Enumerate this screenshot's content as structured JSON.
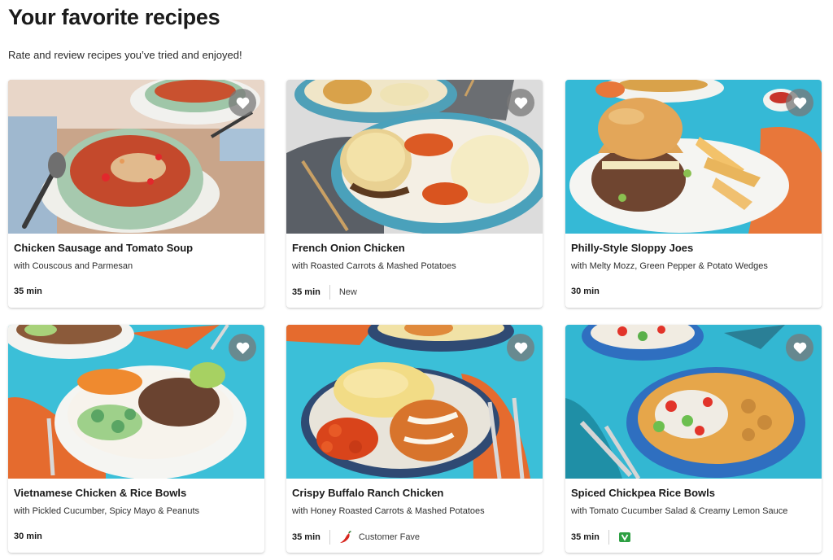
{
  "page": {
    "title": "Your favorite recipes",
    "subtitle": "Rate and review recipes you’ve tried and enjoyed!"
  },
  "colors": {
    "heart_bg": "#7a7a7a",
    "chili": "#d7261e",
    "veggie": "#2ea043",
    "separator": "#d0d0d0"
  },
  "recipes": [
    {
      "title": "Chicken Sausage and Tomato Soup",
      "subtitle": "with Couscous and Parmesan",
      "time": "35 min",
      "tag": "",
      "tag_icon": ""
    },
    {
      "title": "French Onion Chicken",
      "subtitle": "with Roasted Carrots & Mashed Potatoes",
      "time": "35 min",
      "tag": "New",
      "tag_icon": ""
    },
    {
      "title": "Philly-Style Sloppy Joes",
      "subtitle": "with Melty Mozz, Green Pepper & Potato Wedges",
      "time": "30 min",
      "tag": "",
      "tag_icon": ""
    },
    {
      "title": "Vietnamese Chicken & Rice Bowls",
      "subtitle": "with Pickled Cucumber, Spicy Mayo & Peanuts",
      "time": "30 min",
      "tag": "",
      "tag_icon": ""
    },
    {
      "title": "Crispy Buffalo Ranch Chicken",
      "subtitle": "with Honey Roasted Carrots & Mashed Potatoes",
      "time": "35 min",
      "tag": "Customer Fave",
      "tag_icon": "chili-pepper-icon"
    },
    {
      "title": "Spiced Chickpea Rice Bowls",
      "subtitle": "with Tomato Cucumber Salad & Creamy Lemon Sauce",
      "time": "35 min",
      "tag": "",
      "tag_icon": "veggie-icon"
    }
  ]
}
